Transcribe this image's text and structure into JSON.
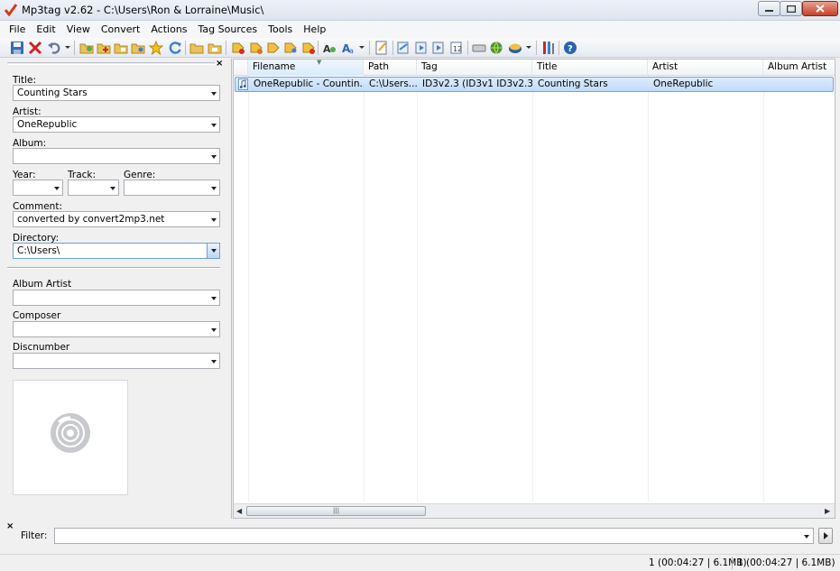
{
  "window": {
    "title": "Mp3tag v2.62  -  C:\\Users\\Ron & Lorraine\\Music\\"
  },
  "menu": [
    "File",
    "Edit",
    "View",
    "Convert",
    "Actions",
    "Tag Sources",
    "Tools",
    "Help"
  ],
  "toolbar": {
    "icons": [
      "save-icon",
      "remove-tag-icon",
      "undo-icon",
      "change-directory-icon",
      "add-directory-icon",
      "favorite-directory-icon",
      "favorites-icon",
      "refresh-icon",
      "open-folder-icon",
      "export-icon",
      "tag-filename-icon",
      "filename-tag-icon",
      "text-file-tag-icon",
      "tag-tag-icon",
      "auto-numbering-icon",
      "actions-icon",
      "case-conversion-icon",
      "extended-tags-icon",
      "playlist-icon",
      "export-list-icon",
      "numbering-wizard-icon",
      "freedb-icon",
      "tag-sources-icon",
      "web-sources-icon",
      "options-icon",
      "help-icon"
    ]
  },
  "tag_panel": {
    "title_label": "Title:",
    "title_value": "Counting Stars",
    "artist_label": "Artist:",
    "artist_value": "OneRepublic",
    "album_label": "Album:",
    "album_value": "",
    "year_label": "Year:",
    "track_label": "Track:",
    "genre_label": "Genre:",
    "comment_label": "Comment:",
    "comment_value": "converted by convert2mp3.net",
    "directory_label": "Directory:",
    "directory_value": "C:\\Users\\",
    "album_artist_label": "Album Artist",
    "composer_label": "Composer",
    "discnumber_label": "Discnumber"
  },
  "file_list": {
    "columns": [
      "Filename",
      "Path",
      "Tag",
      "Title",
      "Artist",
      "Album Artist"
    ],
    "rows": [
      {
        "filename": "OneRepublic - Countin...",
        "path": "C:\\Users...",
        "tag": "ID3v2.3 (ID3v1 ID3v2.3)",
        "title": "Counting Stars",
        "artist": "OneRepublic",
        "album_artist": ""
      }
    ]
  },
  "filter": {
    "label": "Filter:",
    "value": ""
  },
  "status": {
    "selected": "1 (00:04:27 | 6.1MB)",
    "total": "1 (00:04:27 | 6.1MB)"
  }
}
